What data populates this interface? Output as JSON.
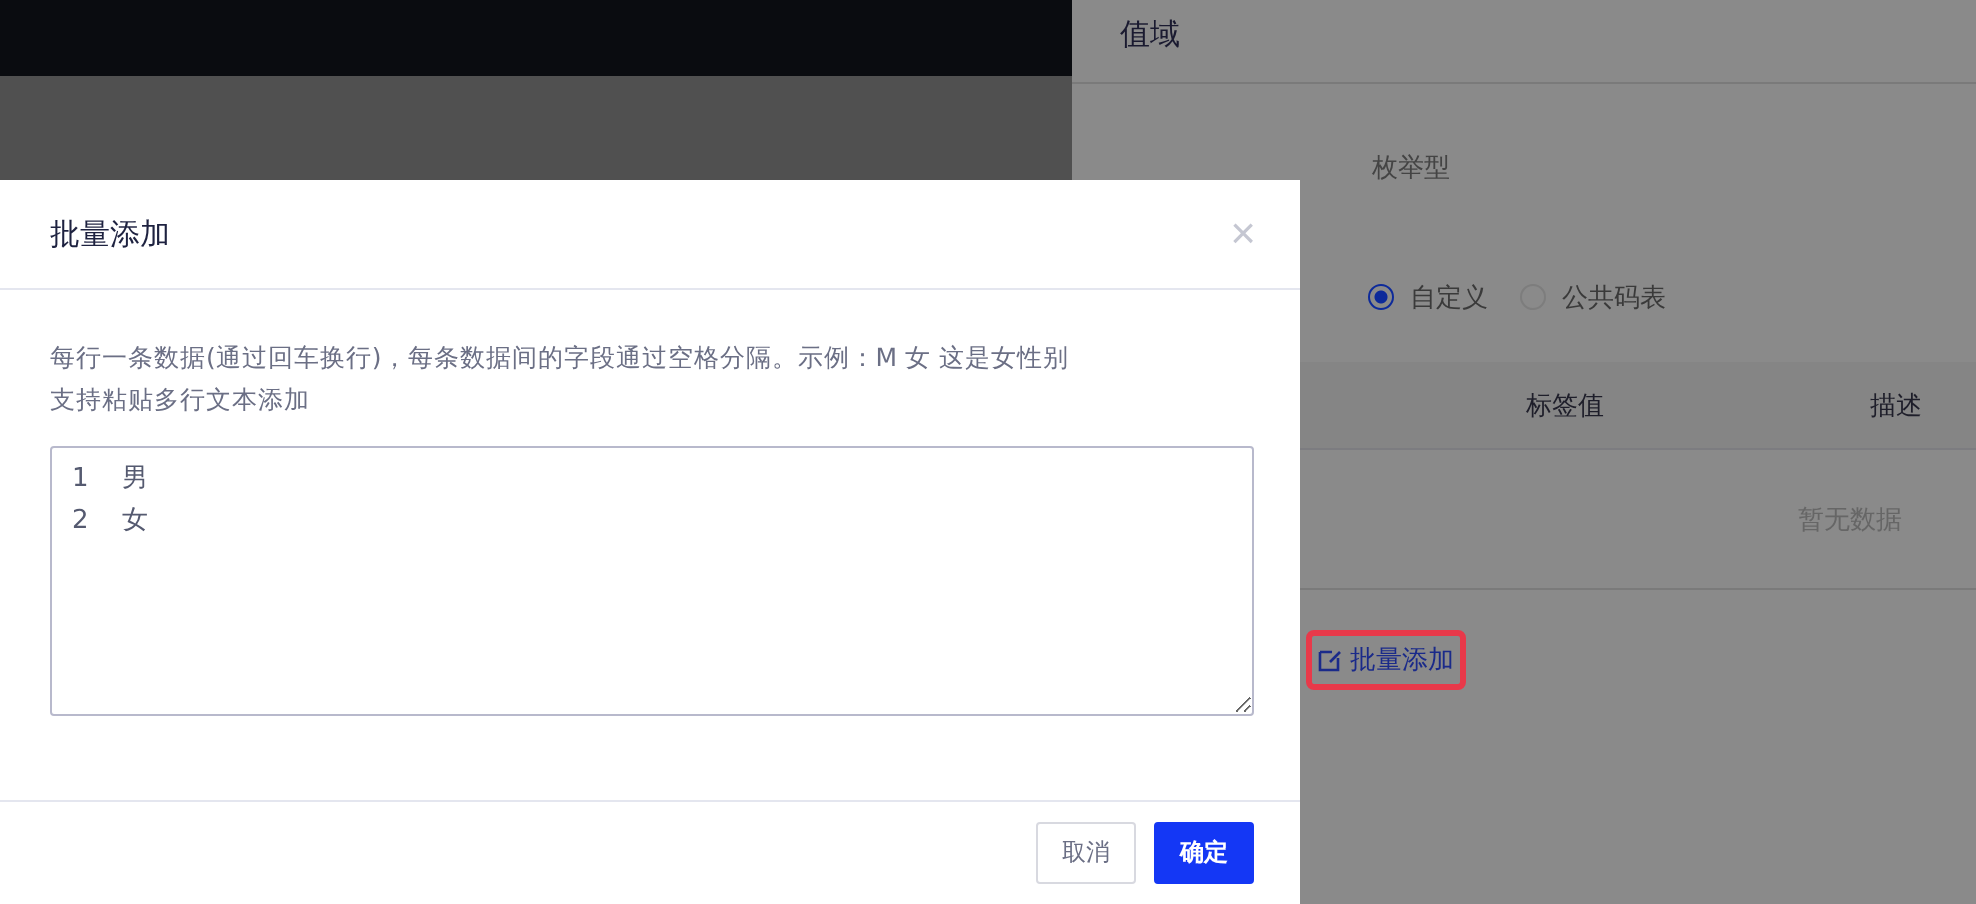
{
  "panel": {
    "section_title": "值域",
    "value_type": "枚举型",
    "source_options": [
      {
        "label": "自定义",
        "selected": true
      },
      {
        "label": "公共码表",
        "selected": false
      }
    ],
    "table": {
      "columns": [
        "标签值",
        "描述"
      ],
      "empty_text": "暂无数据"
    },
    "batch_add_link": {
      "label": "批量添加",
      "highlighted": true
    }
  },
  "dialog": {
    "title": "批量添加",
    "close": "×",
    "hint_lines": [
      "每行一条数据(通过回车换行)，每条数据间的字段通过空格分隔。示例：M 女 这是女性别",
      "支持粘贴多行文本添加"
    ],
    "input_value": "1    男\n2    女",
    "buttons": [
      {
        "label": "取消",
        "kind": "secondary"
      },
      {
        "label": "确定",
        "kind": "primary"
      }
    ]
  }
}
